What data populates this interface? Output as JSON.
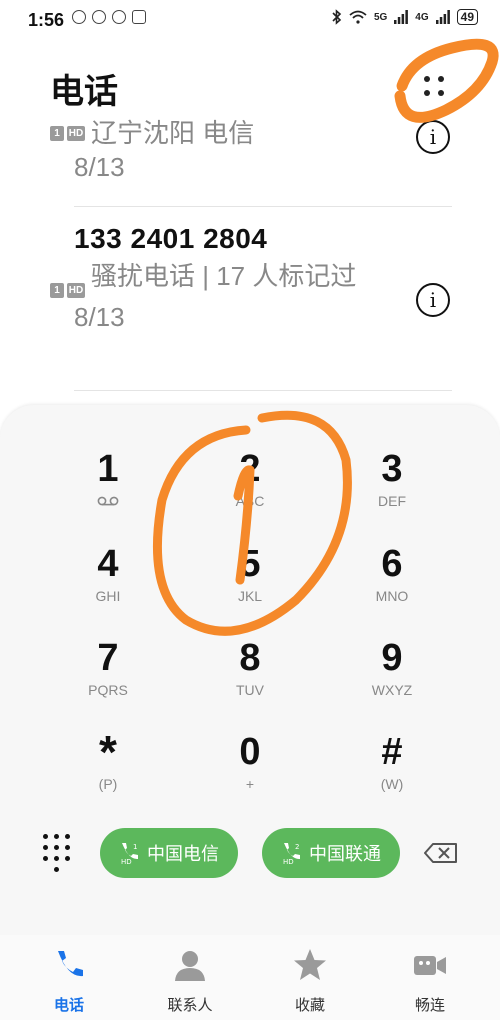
{
  "status_bar": {
    "time": "1:56",
    "signal_1_label": "5G",
    "signal_2_label": "4G",
    "battery": "49"
  },
  "page_title": "电话",
  "call_log": [
    {
      "number": "",
      "label": "辽宁沈阳 电信",
      "date": "8/13"
    },
    {
      "number": "133 2401 2804",
      "label": "骚扰电话 | 17 人标记过",
      "date": "8/13"
    }
  ],
  "sim_badges": {
    "slot": "1",
    "hd": "HD"
  },
  "info_glyph": "i",
  "dialpad": {
    "keys": [
      {
        "digit": "1",
        "letters": "∞"
      },
      {
        "digit": "2",
        "letters": "ABC"
      },
      {
        "digit": "3",
        "letters": "DEF"
      },
      {
        "digit": "4",
        "letters": "GHI"
      },
      {
        "digit": "5",
        "letters": "JKL"
      },
      {
        "digit": "6",
        "letters": "MNO"
      },
      {
        "digit": "7",
        "letters": "PQRS"
      },
      {
        "digit": "8",
        "letters": "TUV"
      },
      {
        "digit": "9",
        "letters": "WXYZ"
      },
      {
        "digit": "*",
        "letters": "(P)"
      },
      {
        "digit": "0",
        "letters": "+"
      },
      {
        "digit": "#",
        "letters": "(W)"
      }
    ]
  },
  "sim_buttons": [
    {
      "label": "中国电信",
      "sim": "1"
    },
    {
      "label": "中国联通",
      "sim": "2"
    }
  ],
  "tabs": [
    {
      "label": "电话",
      "icon": "phone-icon",
      "active": true
    },
    {
      "label": "联系人",
      "icon": "contacts-icon",
      "active": false
    },
    {
      "label": "收藏",
      "icon": "star-icon",
      "active": false
    },
    {
      "label": "畅连",
      "icon": "video-call-icon",
      "active": false
    }
  ],
  "colors": {
    "accent": "#1a73e8",
    "call_button": "#5cb85c",
    "scribble": "#f5892a"
  }
}
